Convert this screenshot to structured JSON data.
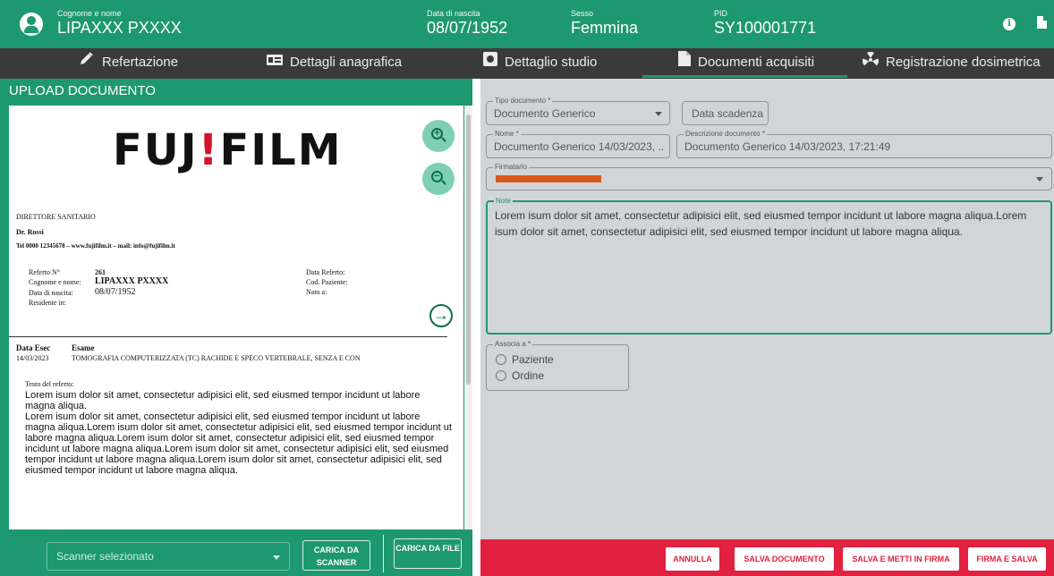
{
  "header": {
    "name_label": "Cognome e nome",
    "name_value": "LIPAXXX PXXXX",
    "dob_label": "Data di nascita",
    "dob_value": "08/07/1952",
    "sex_label": "Sesso",
    "sex_value": "Femmina",
    "pid_label": "PID",
    "pid_value": "SY100001771",
    "info_icon": "info-icon",
    "save_icon": "save-icon"
  },
  "tabs": [
    {
      "label": "Refertazione",
      "icon": "pencil-icon"
    },
    {
      "label": "Dettagli anagrafica",
      "icon": "id-card-icon"
    },
    {
      "label": "Dettaglio studio",
      "icon": "image-icon"
    },
    {
      "label": "Documenti acquisiti",
      "icon": "document-icon",
      "active": true
    },
    {
      "label": "Registrazione dosimetrica",
      "icon": "radiation-icon"
    }
  ],
  "upload": {
    "title": "UPLOAD DOCUMENTO",
    "scanner_placeholder": "Scanner selezionato",
    "btn_scanner": "CARICA DA SCANNER",
    "btn_file": "CARICA DA FILE"
  },
  "document": {
    "logo_text": "FUJIFILM",
    "director": "DIRETTORE SANITARIO",
    "doctor": "Dr. Rossi",
    "contacts": "Tel 0000 12345678 – www.fujifilm.it – mail: info@fujifilm.it",
    "referto_label": "Referto N°",
    "referto_value": "261",
    "name_label": "Cognome e nome:",
    "name_value": "LIPAXXX PXXXX",
    "dob_label": "Data di nascita:",
    "dob_value": "08/07/1952",
    "residence_label": "Residente in:",
    "data_referto_label": "Data Referto:",
    "cod_paziente_label": "Cod. Paziente:",
    "nato_label": "Nato a:",
    "data_esec_label": "Data Esec",
    "esame_label": "Esame",
    "data_esec_value": "14/03/2023",
    "esame_value": "TOMOGRAFIA COMPUTERIZZATA (TC) RACHIDE E SPECO VERTEBRALE, SENZA E CON",
    "testo_label": "Testo del referto:",
    "paragraph1": "Lorem isum dolor sit amet, consectetur adipisici elit, sed eiusmed tempor incidunt ut labore magna aliqua.",
    "paragraph2": "Lorem isum dolor sit amet, consectetur adipisici elit, sed eiusmed tempor incidunt ut labore magna aliqua.Lorem isum dolor sit amet, consectetur adipisici elit, sed eiusmed tempor incidunt ut labore magna aliqua.Lorem isum dolor sit amet, consectetur adipisici elit, sed eiusmed tempor incidunt ut labore magna aliqua.Lorem isum dolor sit amet, consectetur adipisici elit, sed eiusmed tempor incidunt ut labore magna aliqua.Lorem isum dolor sit amet, consectetur adipisici elit, sed eiusmed tempor incidunt ut labore magna aliqua."
  },
  "form": {
    "tipo_label": "Tipo documento *",
    "tipo_value": "Documento Generico",
    "data_scadenza": "Data scadenza",
    "nome_label": "Nome *",
    "nome_value": "Documento Generico 14/03/2023, ...",
    "descr_label": "Descrizione documento *",
    "descr_value": "Documento Generico 14/03/2023, 17:21:49",
    "firmatario_label": "Firmatario",
    "note_label": "Note",
    "note_value": "Lorem isum dolor sit amet, consectetur adipisici elit, sed eiusmed tempor incidunt ut labore magna aliqua.Lorem isum dolor sit amet, consectetur adipisici elit, sed eiusmed tempor incidunt ut labore magna aliqua.",
    "associa_label": "Associa a *",
    "option_paziente": "Paziente",
    "option_ordine": "Ordine"
  },
  "actions": {
    "annulla": "ANNULLA",
    "salva_documento": "SALVA DOCUMENTO",
    "salva_e_metti": "SALVA E METTI IN FIRMA",
    "firma_e_salva": "FIRMA E SALVA"
  },
  "colors": {
    "primary_green": "#1e9870",
    "dark_tabbar": "#3a3a3a",
    "form_bg": "#d2d5d8",
    "action_red": "#e2203f",
    "redaction_orange": "#d8581c"
  }
}
